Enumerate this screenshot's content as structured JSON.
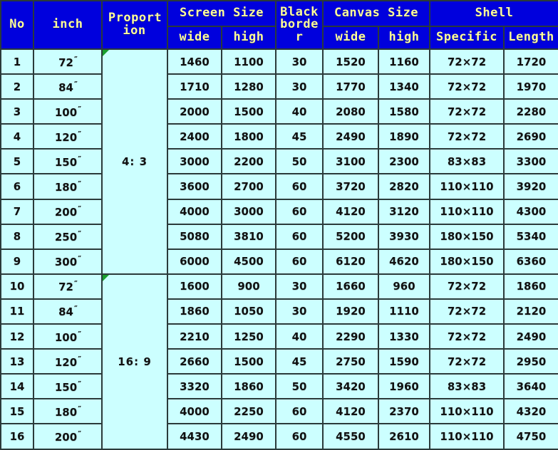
{
  "table": {
    "columns": {
      "no": "No",
      "inch": "inch",
      "proportion": "Proport ion",
      "screen_size": "Screen Size",
      "screen_wide": "wide",
      "screen_high": "high",
      "black_border": "Black border",
      "canvas_size": "Canvas Size",
      "canvas_wide": "wide",
      "canvas_high": "high",
      "shell": "Shell",
      "shell_specific": "Specific",
      "shell_length": "Length"
    },
    "groups": [
      {
        "proportion": "4: 3",
        "rows": [
          {
            "no": "1",
            "inch": "72",
            "inch_mark": "″",
            "screen_wide": "1460",
            "screen_high": "1100",
            "black_border": "30",
            "canvas_wide": "1520",
            "canvas_high": "1160",
            "shell_specific": "72×72",
            "shell_length": "1720"
          },
          {
            "no": "2",
            "inch": "84",
            "inch_mark": "″",
            "screen_wide": "1710",
            "screen_high": "1280",
            "black_border": "30",
            "canvas_wide": "1770",
            "canvas_high": "1340",
            "shell_specific": "72×72",
            "shell_length": "1970"
          },
          {
            "no": "3",
            "inch": "100",
            "inch_mark": "″",
            "screen_wide": "2000",
            "screen_high": "1500",
            "black_border": "40",
            "canvas_wide": "2080",
            "canvas_high": "1580",
            "shell_specific": "72×72",
            "shell_length": "2280"
          },
          {
            "no": "4",
            "inch": "120",
            "inch_mark": "″",
            "screen_wide": "2400",
            "screen_high": "1800",
            "black_border": "45",
            "canvas_wide": "2490",
            "canvas_high": "1890",
            "shell_specific": "72×72",
            "shell_length": "2690"
          },
          {
            "no": "5",
            "inch": "150",
            "inch_mark": "″",
            "screen_wide": "3000",
            "screen_high": "2200",
            "black_border": "50",
            "canvas_wide": "3100",
            "canvas_high": "2300",
            "shell_specific": "83×83",
            "shell_length": "3300"
          },
          {
            "no": "6",
            "inch": "180",
            "inch_mark": "″",
            "screen_wide": "3600",
            "screen_high": "2700",
            "black_border": "60",
            "canvas_wide": "3720",
            "canvas_high": "2820",
            "shell_specific": "110×110",
            "shell_length": "3920"
          },
          {
            "no": "7",
            "inch": "200",
            "inch_mark": "″",
            "screen_wide": "4000",
            "screen_high": "3000",
            "black_border": "60",
            "canvas_wide": "4120",
            "canvas_high": "3120",
            "shell_specific": "110×110",
            "shell_length": "4300"
          },
          {
            "no": "8",
            "inch": "250",
            "inch_mark": "″",
            "screen_wide": "5080",
            "screen_high": "3810",
            "black_border": "60",
            "canvas_wide": "5200",
            "canvas_high": "3930",
            "shell_specific": "180×150",
            "shell_length": "5340"
          },
          {
            "no": "9",
            "inch": "300",
            "inch_mark": "″",
            "screen_wide": "6000",
            "screen_high": "4500",
            "black_border": "60",
            "canvas_wide": "6120",
            "canvas_high": "4620",
            "shell_specific": "180×150",
            "shell_length": "6360"
          }
        ]
      },
      {
        "proportion": "16: 9",
        "rows": [
          {
            "no": "10",
            "inch": "72",
            "inch_mark": "″",
            "screen_wide": "1600",
            "screen_high": "900",
            "black_border": "30",
            "canvas_wide": "1660",
            "canvas_high": "960",
            "shell_specific": "72×72",
            "shell_length": "1860"
          },
          {
            "no": "11",
            "inch": "84",
            "inch_mark": "″",
            "screen_wide": "1860",
            "screen_high": "1050",
            "black_border": "30",
            "canvas_wide": "1920",
            "canvas_high": "1110",
            "shell_specific": "72×72",
            "shell_length": "2120"
          },
          {
            "no": "12",
            "inch": "100",
            "inch_mark": "″",
            "screen_wide": "2210",
            "screen_high": "1250",
            "black_border": "40",
            "canvas_wide": "2290",
            "canvas_high": "1330",
            "shell_specific": "72×72",
            "shell_length": "2490"
          },
          {
            "no": "13",
            "inch": "120",
            "inch_mark": "″",
            "screen_wide": "2660",
            "screen_high": "1500",
            "black_border": "45",
            "canvas_wide": "2750",
            "canvas_high": "1590",
            "shell_specific": "72×72",
            "shell_length": "2950"
          },
          {
            "no": "14",
            "inch": "150",
            "inch_mark": "″",
            "screen_wide": "3320",
            "screen_high": "1860",
            "black_border": "50",
            "canvas_wide": "3420",
            "canvas_high": "1960",
            "shell_specific": "83×83",
            "shell_length": "3640"
          },
          {
            "no": "15",
            "inch": "180",
            "inch_mark": "″",
            "screen_wide": "4000",
            "screen_high": "2250",
            "black_border": "60",
            "canvas_wide": "4120",
            "canvas_high": "2370",
            "shell_specific": "110×110",
            "shell_length": "4320"
          },
          {
            "no": "16",
            "inch": "200",
            "inch_mark": "″",
            "screen_wide": "4430",
            "screen_high": "2490",
            "black_border": "60",
            "canvas_wide": "4550",
            "canvas_high": "2610",
            "shell_specific": "110×110",
            "shell_length": "4750"
          }
        ]
      }
    ]
  },
  "colors": {
    "header_bg": "#0000DD",
    "header_text": "#FFFF99",
    "cell_bg": "#CCFFFF",
    "cell_text": "#111111",
    "grid_line": "#2b3a3a",
    "comment_marker": "#1a9e2e"
  }
}
